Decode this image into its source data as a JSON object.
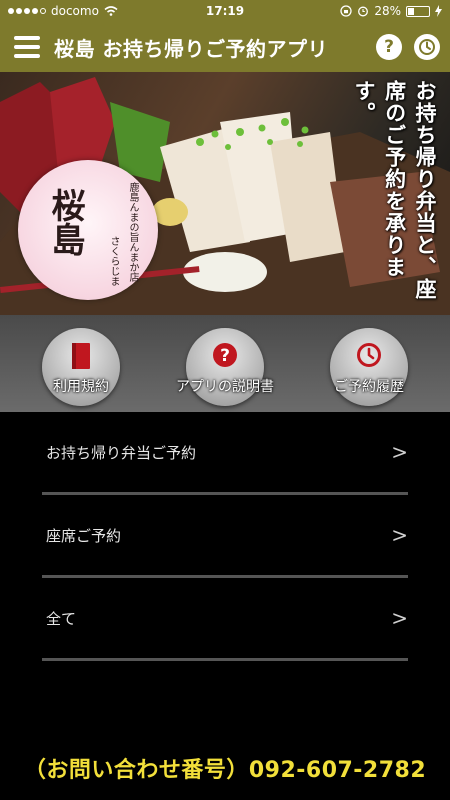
{
  "status_bar": {
    "carrier": "docomo",
    "time": "17:19",
    "battery": "28%",
    "battery_level": 0.28
  },
  "header": {
    "title": "桜島 お持ち帰りご予約アプリ",
    "help_icon": "question-circle-icon",
    "history_icon": "clock-icon"
  },
  "hero": {
    "tagline": "お持ち帰り弁当と、座席のご予約を承ります。",
    "logo": {
      "subtitle": "鹿島んまの旨んまか店",
      "name": "桜島",
      "reading": "さくらじま"
    }
  },
  "buttons": [
    {
      "label": "利用規約",
      "icon": "book-icon"
    },
    {
      "label": "アプリの説明書",
      "icon": "question-icon"
    },
    {
      "label": "ご予約履歴",
      "icon": "clock-icon"
    }
  ],
  "menu": [
    {
      "label": "お持ち帰り弁当ご予約",
      "arrow": ">"
    },
    {
      "label": "座席ご予約",
      "arrow": ">"
    },
    {
      "label": "全て",
      "arrow": ">"
    }
  ],
  "footer": {
    "contact": "（お問い合わせ番号）092-607-2782"
  },
  "colors": {
    "header": "#7e7a2c",
    "footer_text": "#f2df3a",
    "icon_red": "#c0171f"
  }
}
